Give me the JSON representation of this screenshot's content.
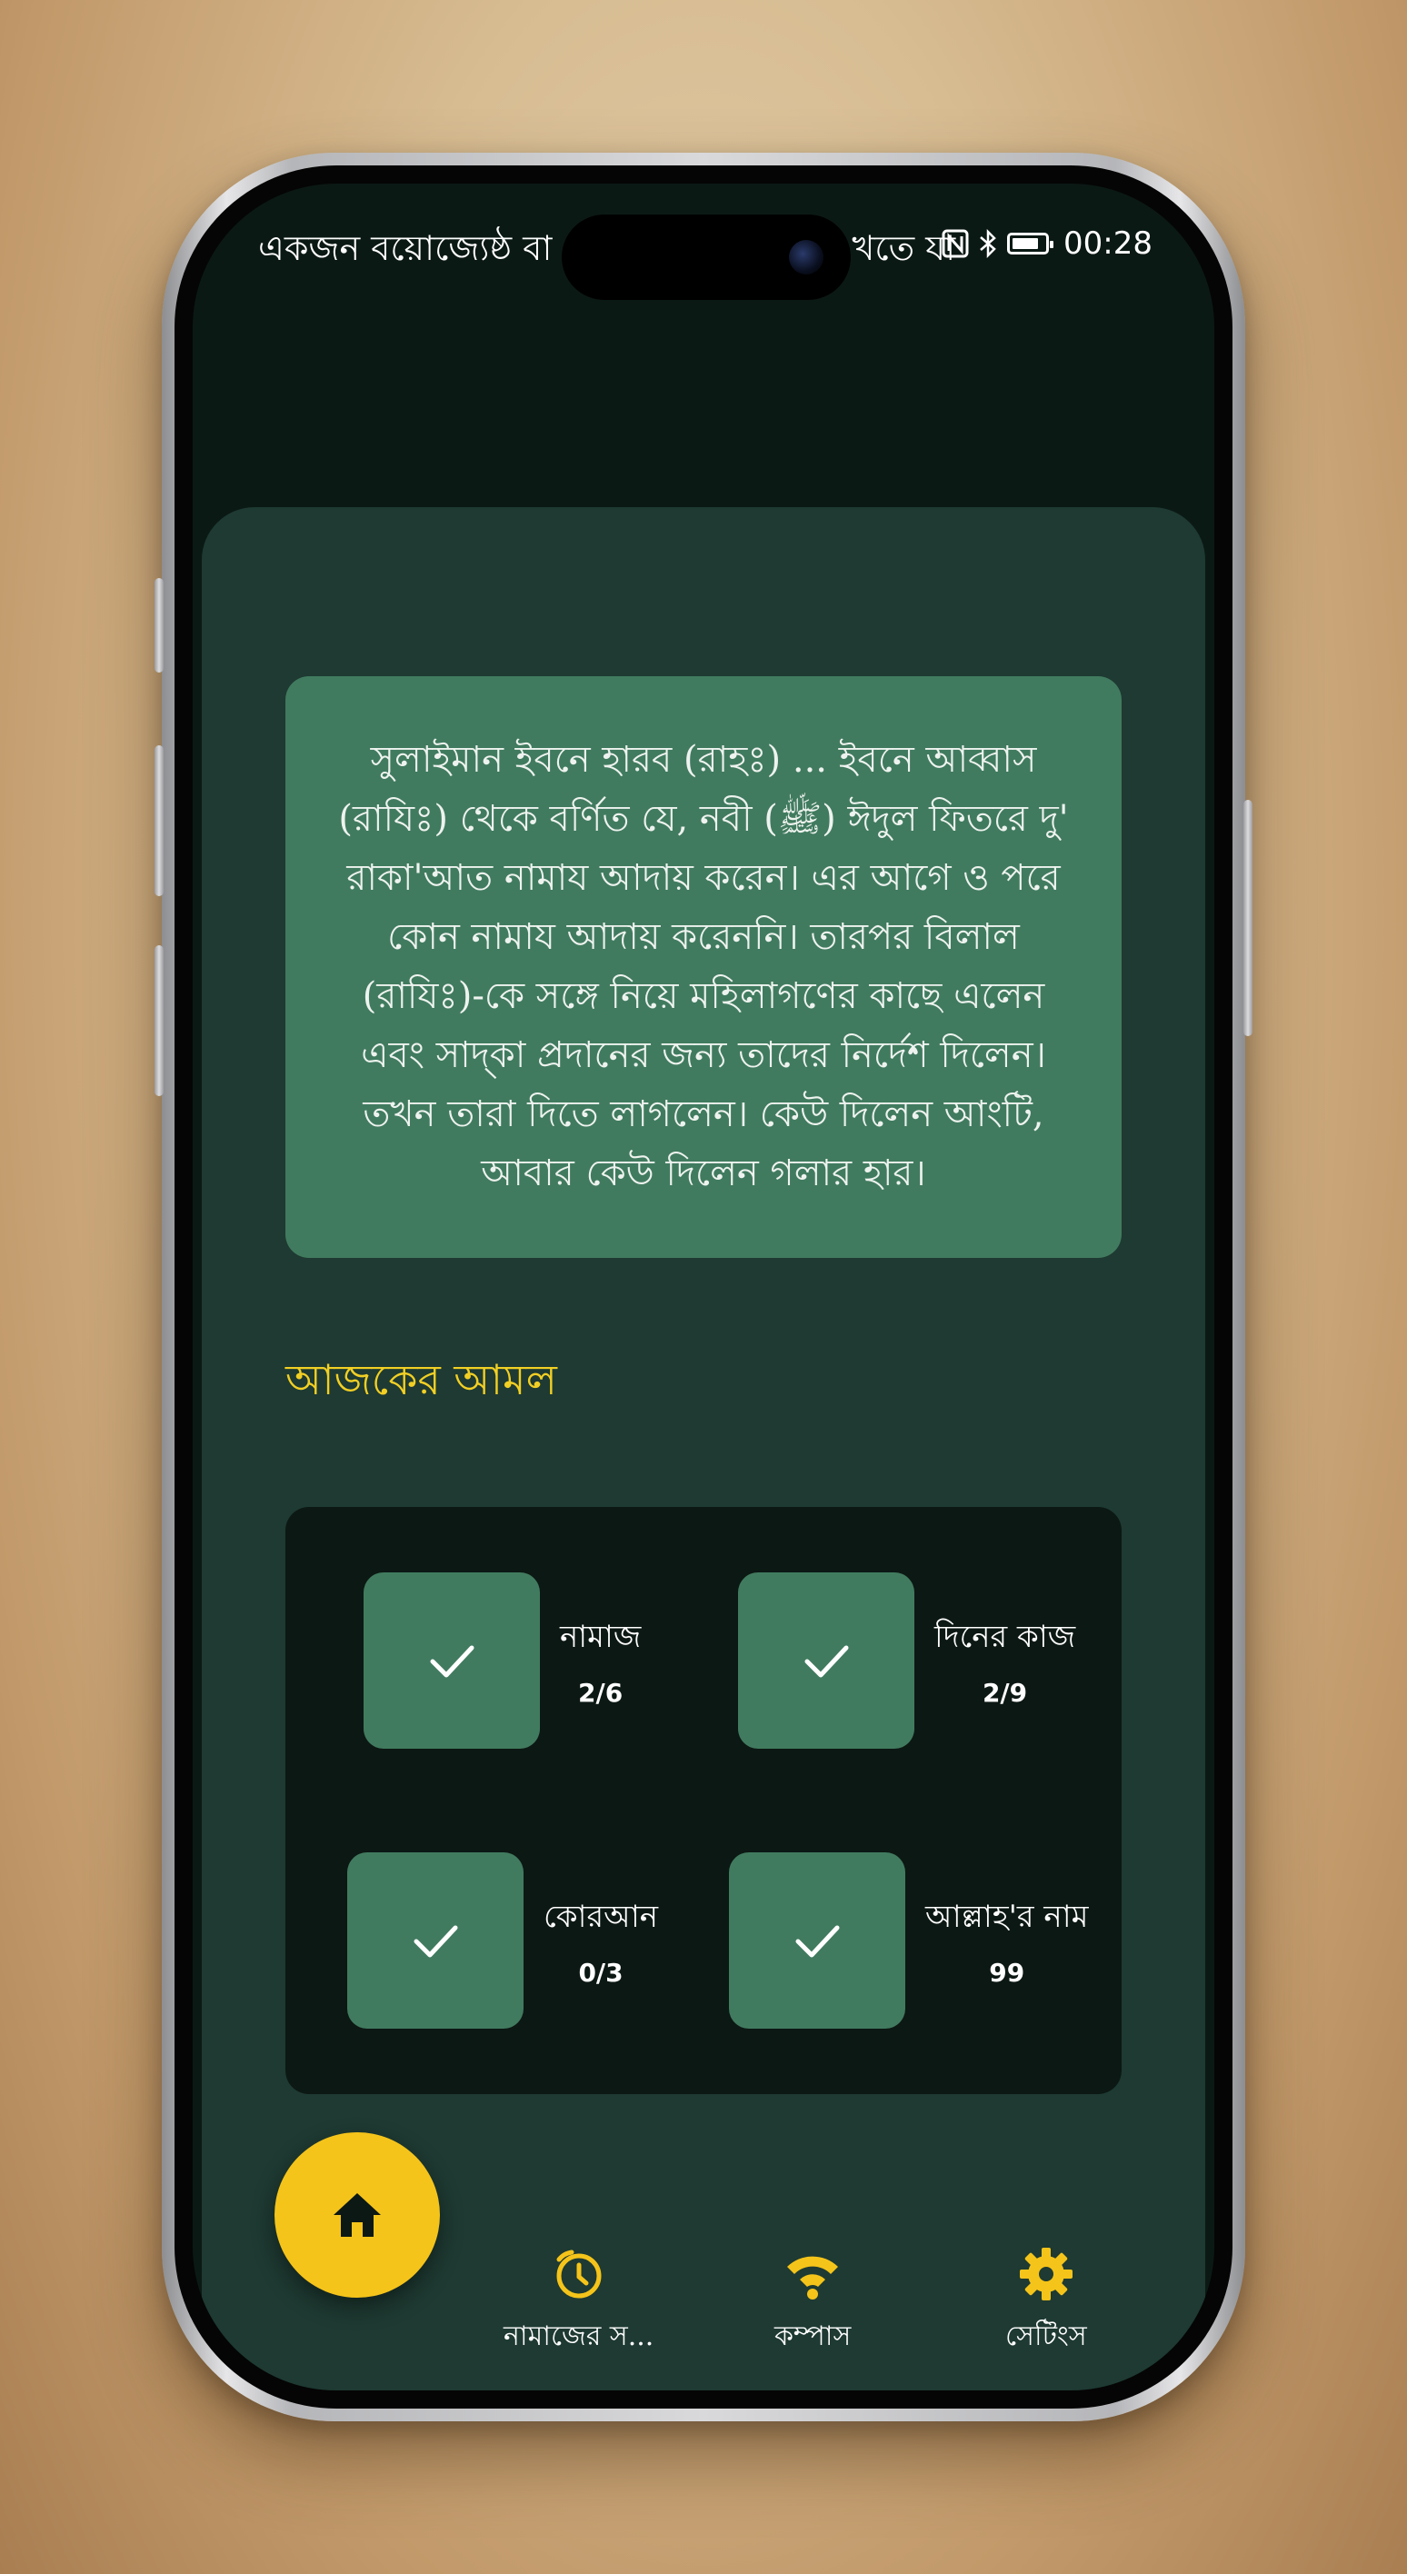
{
  "colors": {
    "background": "#d8bd93",
    "screen_top": "#0b1915",
    "panel": "#1e3a32",
    "card": "#417b5f",
    "amal_panel": "#0c1814",
    "accent_yellow": "#f5c41a",
    "title_yellow": "#f2cf24"
  },
  "status_bar": {
    "ticker_text": "একজন বয়োজ্যেষ্ঠ বা",
    "ticker_tail": "খতে যা",
    "time": "00:28",
    "icons": [
      "nfc-icon",
      "bluetooth-icon",
      "battery-icon"
    ]
  },
  "hadith": {
    "text": "সুলাইমান ইবনে হারব (রাহঃ) ... ইবনে আব্বাস (রাযিঃ) থেকে বর্ণিত যে, নবী (ﷺ) ঈদুল ফিতরে দু' রাকা'আত নামায আদায় করেন। এর আগে ও পরে কোন নামায আদায় করেননি। তারপর বিলাল (রাযিঃ)-কে সঙ্গে নিয়ে মহিলাগণের কাছে এলেন এবং সাদ্‌কা প্রদানের জন্য তাদের নির্দেশ দিলেন। তখন তারা দিতে লাগলেন। কেউ দিলেন আংটি, আবার কেউ দিলেন গলার হার।"
  },
  "section_title": "আজকের আমল",
  "amal": [
    {
      "label": "নামাজ",
      "count": "2/6",
      "icon": "check-icon"
    },
    {
      "label": "দিনের কাজ",
      "count": "2/9",
      "icon": "check-icon"
    },
    {
      "label": "কোরআন",
      "count": "0/3",
      "icon": "check-icon"
    },
    {
      "label": "আল্লাহ'র নাম",
      "count": "99",
      "icon": "check-icon"
    }
  ],
  "bottom_nav": {
    "home_icon": "home-icon",
    "items": [
      {
        "label": "নামাজের স...",
        "icon": "prayer-time-icon"
      },
      {
        "label": "কম্পাস",
        "icon": "compass-icon"
      },
      {
        "label": "সেটিংস",
        "icon": "gear-icon"
      }
    ]
  }
}
